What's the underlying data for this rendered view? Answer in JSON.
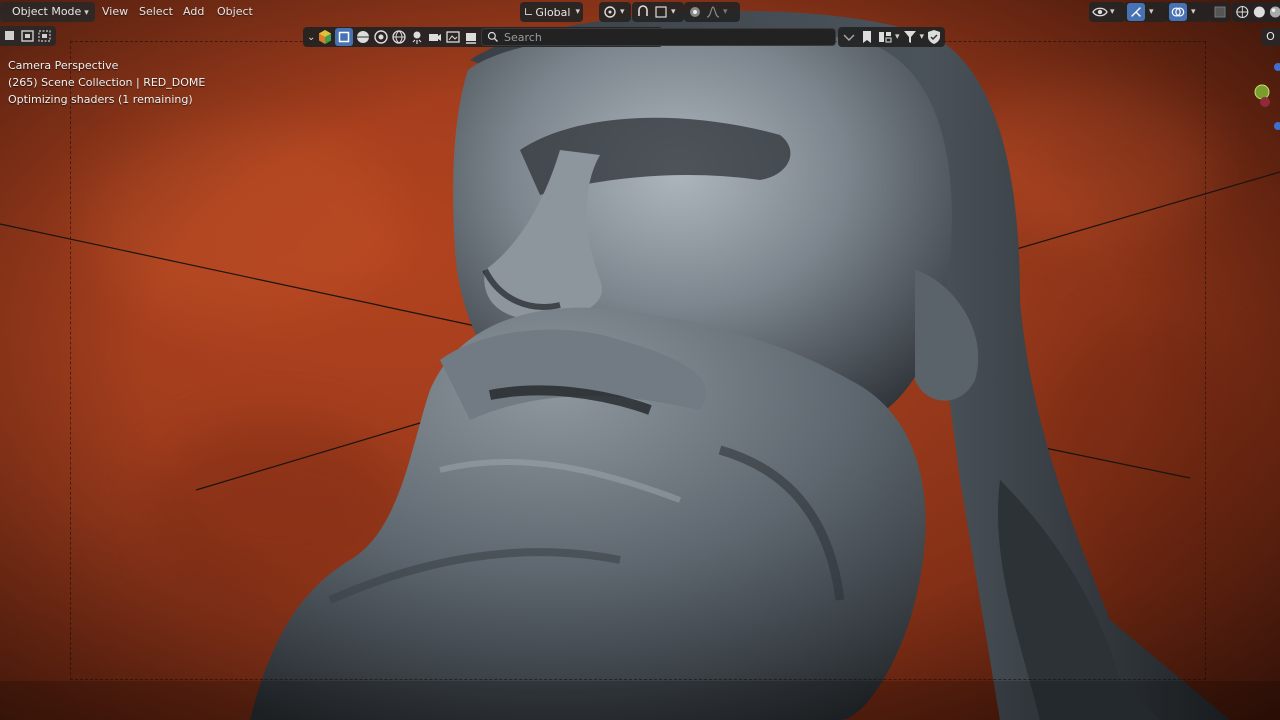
{
  "header": {
    "mode_label": "Object Mode",
    "menus": [
      "View",
      "Select",
      "Add",
      "Object"
    ],
    "transform_orientation": "Global"
  },
  "toolbar": {
    "search_placeholder": "Search"
  },
  "overlay": {
    "line1": "Camera Perspective",
    "line2": "(265) Scene Collection | RED_DOME",
    "line3": "Optimizing shaders (1 remaining)"
  },
  "right_tab_label": "O",
  "colors": {
    "accent": "#4772b3",
    "background_red": "#9a3a1c",
    "header_bg": "#282828"
  },
  "icons": [
    "view-icon",
    "select-icon",
    "transform-icon",
    "snap-icon",
    "proportional-icon",
    "overlay-icon",
    "gizmo-icon",
    "shading-icon",
    "filter-icon",
    "bookmark-icon",
    "shield-icon"
  ]
}
